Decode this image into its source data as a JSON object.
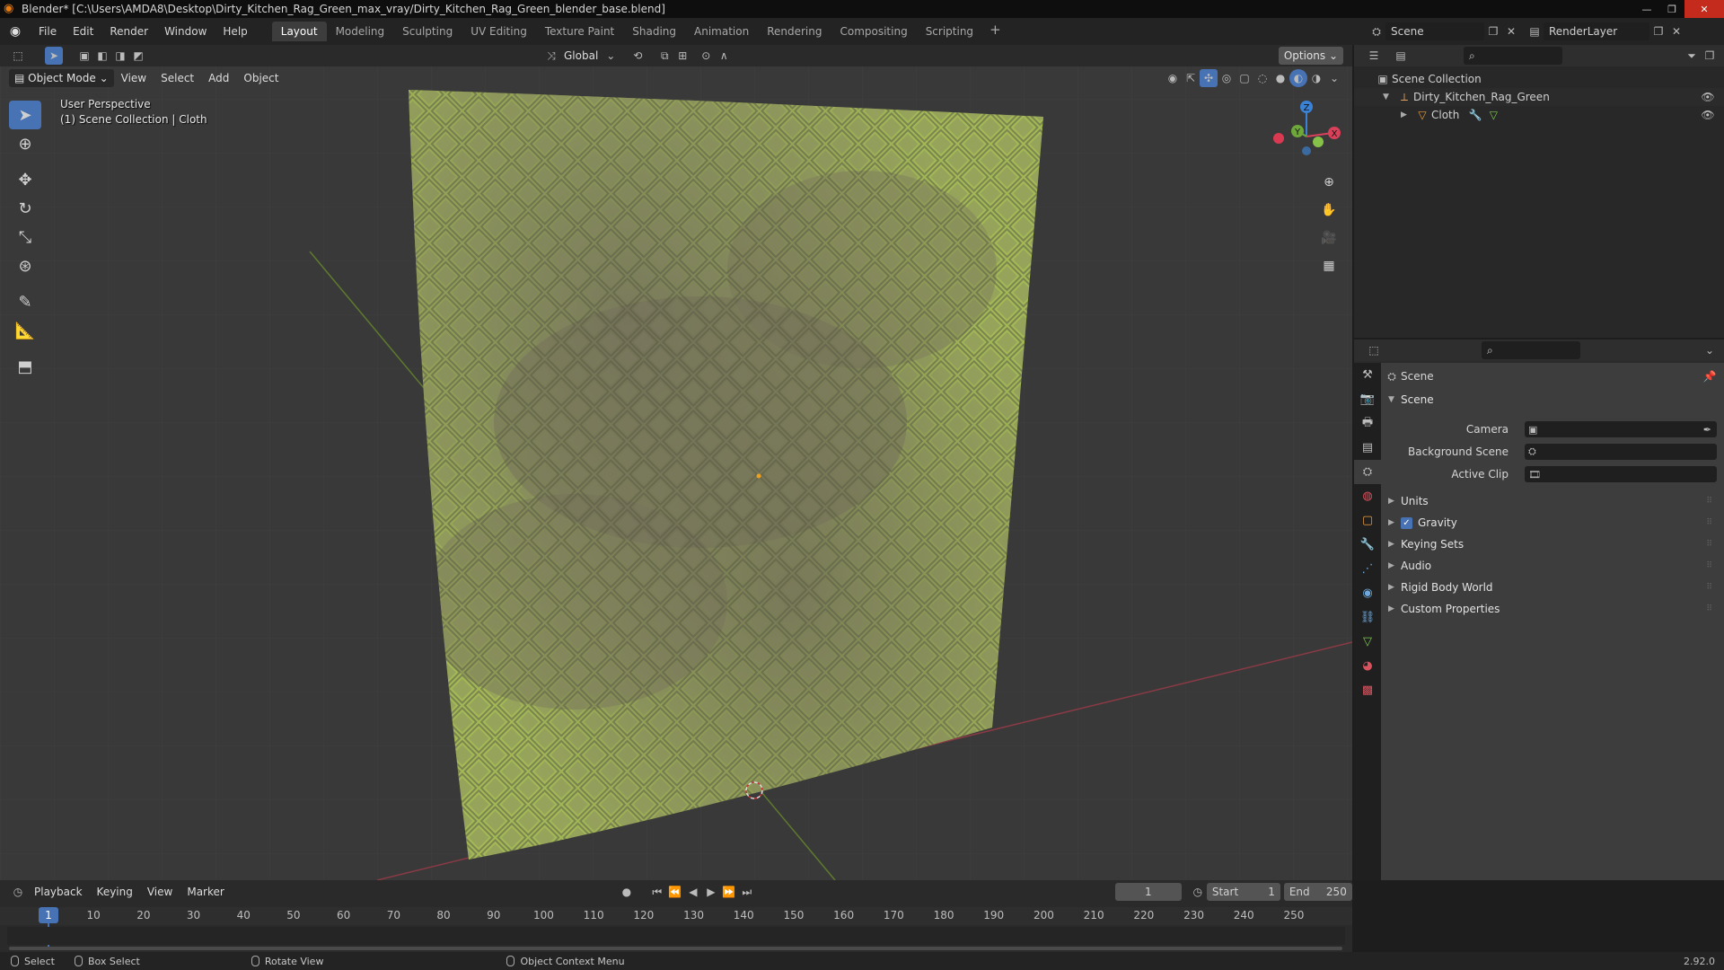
{
  "titlebar": {
    "title": "Blender* [C:\\Users\\AMDA8\\Desktop\\Dirty_Kitchen_Rag_Green_max_vray/Dirty_Kitchen_Rag_Green_blender_base.blend]"
  },
  "menubar": {
    "items": [
      "File",
      "Edit",
      "Render",
      "Window",
      "Help"
    ]
  },
  "workspaces": {
    "tabs": [
      "Layout",
      "Modeling",
      "Sculpting",
      "UV Editing",
      "Texture Paint",
      "Shading",
      "Animation",
      "Rendering",
      "Compositing",
      "Scripting"
    ],
    "active": "Layout"
  },
  "scene_selector": {
    "scene": "Scene",
    "view_layer": "RenderLayer"
  },
  "viewport": {
    "transform_orientation": "Global",
    "options_label": "Options",
    "mode": "Object Mode",
    "menus": [
      "View",
      "Select",
      "Add",
      "Object"
    ],
    "overlay_line1": "User Perspective",
    "overlay_line2": "(1) Scene Collection | Cloth",
    "gizmo_axes": {
      "x": "X",
      "y": "Y",
      "z": "Z"
    }
  },
  "outliner": {
    "root": "Scene Collection",
    "collection": "Dirty_Kitchen_Rag_Green",
    "object": "Cloth"
  },
  "properties": {
    "context_title": "Scene",
    "panel_title": "Scene",
    "fields": [
      {
        "label": "Camera"
      },
      {
        "label": "Background Scene"
      },
      {
        "label": "Active Clip"
      }
    ],
    "subpanels": [
      "Units",
      "Gravity",
      "Keying Sets",
      "Audio",
      "Rigid Body World",
      "Custom Properties"
    ],
    "gravity_enabled": true
  },
  "timeline": {
    "menus": [
      "Playback",
      "Keying",
      "View",
      "Marker"
    ],
    "current_frame": "1",
    "start_label": "Start",
    "start": "1",
    "end_label": "End",
    "end": "250",
    "ticks": [
      "1",
      "10",
      "20",
      "30",
      "40",
      "50",
      "60",
      "70",
      "80",
      "90",
      "100",
      "110",
      "120",
      "130",
      "140",
      "150",
      "160",
      "170",
      "180",
      "190",
      "200",
      "210",
      "220",
      "230",
      "240",
      "250"
    ]
  },
  "statusbar": {
    "select": "Select",
    "box_select": "Box Select",
    "rotate_view": "Rotate View",
    "context_menu": "Object Context Menu",
    "version": "2.92.0"
  },
  "colors": {
    "accent": "#4772b3",
    "x_axis": "#d9405a",
    "y_axis": "#6ea83a",
    "z_axis": "#3b82d6",
    "cloth_light": "#a6bf55",
    "cloth_dark": "#6e6a58"
  }
}
